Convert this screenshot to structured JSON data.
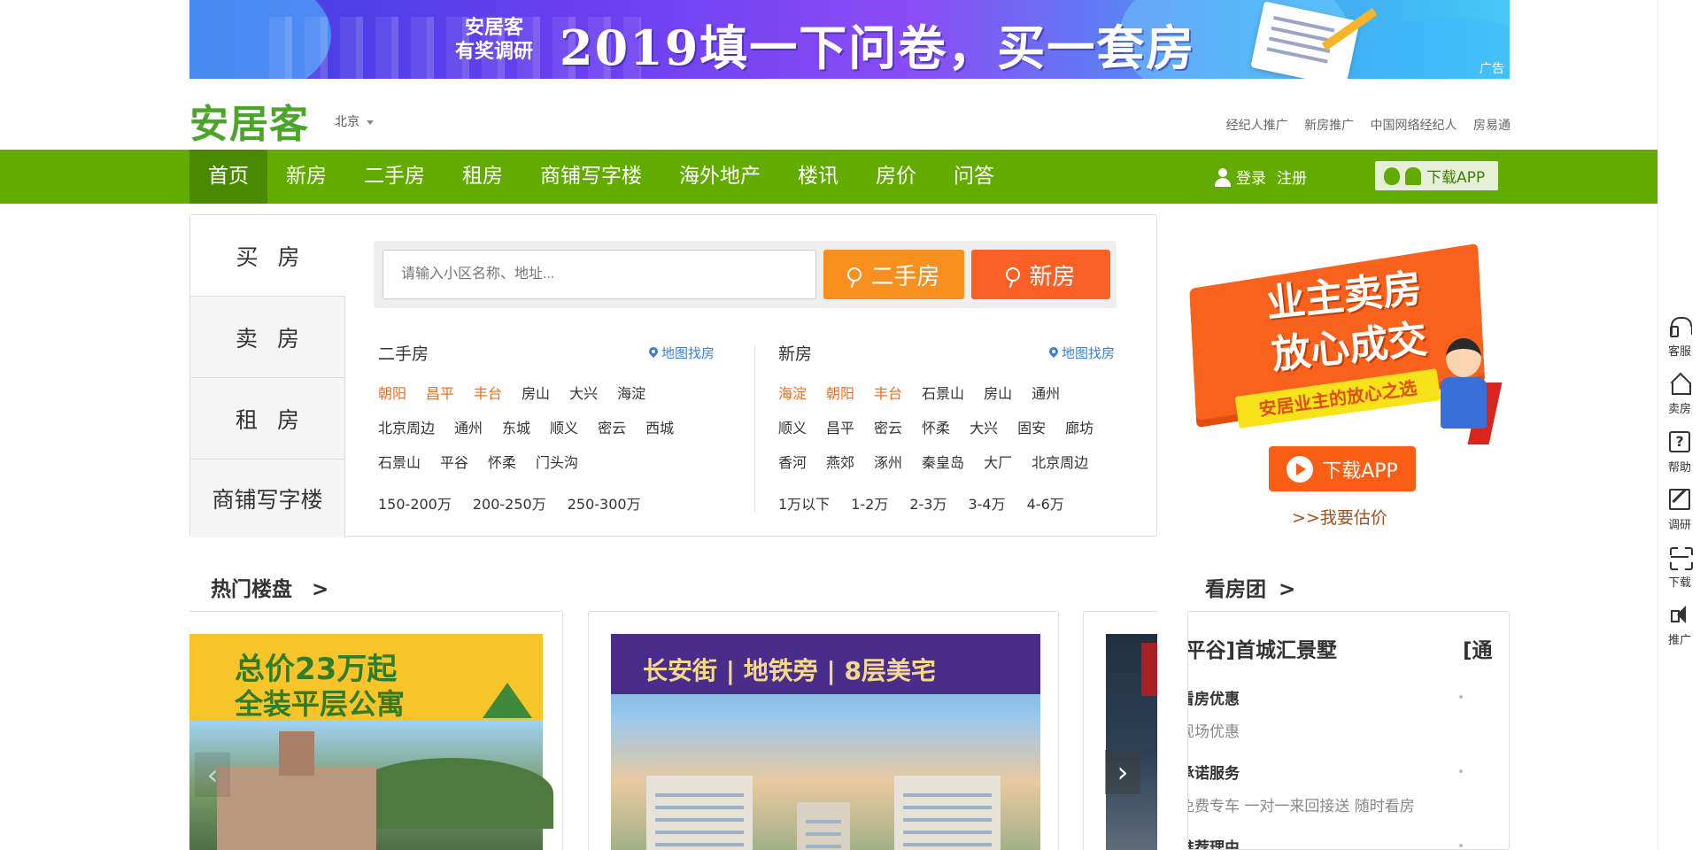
{
  "banner": {
    "brand_line1": "安居客",
    "brand_line2": "有奖调研",
    "headline": "2019填一下问卷，买一套房",
    "ad_tag": "广告"
  },
  "header": {
    "logo": "安居客",
    "city": "北京",
    "top_links": [
      "经纪人推广",
      "新房推广",
      "中国网络经纪人",
      "房易通"
    ]
  },
  "nav": {
    "items": [
      "首页",
      "新房",
      "二手房",
      "租房",
      "商铺写字楼",
      "海外地产",
      "楼讯",
      "房价",
      "问答"
    ],
    "login": "登录",
    "register": "注册",
    "download_app": "下载APP"
  },
  "panel": {
    "tabs": [
      "买房",
      "卖房",
      "租房",
      "商铺写字楼"
    ],
    "search_placeholder": "请输入小区名称、地址...",
    "btn_second_hand": "二手房",
    "btn_new": "新房",
    "second_hand": {
      "title": "二手房",
      "map_link": "地图找房",
      "hot_districts": [
        "朝阳",
        "昌平",
        "丰台"
      ],
      "districts_row1": [
        "房山",
        "大兴",
        "海淀"
      ],
      "districts_row2": [
        "北京周边",
        "通州",
        "东城",
        "顺义",
        "密云",
        "西城"
      ],
      "districts_row3": [
        "石景山",
        "平谷",
        "怀柔",
        "门头沟"
      ],
      "prices": [
        "150-200万",
        "200-250万",
        "250-300万"
      ]
    },
    "new_house": {
      "title": "新房",
      "map_link": "地图找房",
      "hot_districts": [
        "海淀",
        "朝阳",
        "丰台"
      ],
      "districts_row1": [
        "石景山",
        "房山",
        "通州"
      ],
      "districts_row2": [
        "顺义",
        "昌平",
        "密云",
        "怀柔",
        "大兴",
        "固安",
        "廊坊"
      ],
      "districts_row3": [
        "香河",
        "燕郊",
        "涿州",
        "秦皇岛",
        "大厂",
        "北京周边"
      ],
      "prices": [
        "1万以下",
        "1-2万",
        "2-3万",
        "3-4万",
        "4-6万"
      ]
    }
  },
  "promo": {
    "line1": "业主卖房",
    "line2": "放心成交",
    "ribbon": "安居业主的放心之选",
    "download_btn": "下载APP",
    "estimate_link": ">>我要估价"
  },
  "hot_listings": {
    "title": "热门楼盘",
    "arrow": ">",
    "card1_line1": "总价23万起",
    "card1_line2": "全装平层公寓",
    "card2_headline": "长安街 | 地铁旁 | 8层美宅",
    "prev": "‹",
    "next": "›"
  },
  "viewing_group": {
    "title": "看房团",
    "arrow": ">",
    "listing_name": "[平谷]首城汇景墅",
    "listing_name_next": "[通",
    "blocks": [
      {
        "title": "看房优惠",
        "desc": "现场优惠"
      },
      {
        "title": "承诺服务",
        "desc": "免费专车 一对一来回接送 随时看房"
      },
      {
        "title": "推荐理由",
        "desc": ""
      }
    ]
  },
  "sidebar": {
    "items": [
      "客服",
      "卖房",
      "帮助",
      "调研",
      "下载",
      "推广"
    ]
  },
  "colors": {
    "nav_green": "#62ab00",
    "orange_button": "#f7901e",
    "red_orange_button": "#fa6024",
    "hot_district": "#f26c1d",
    "map_link_blue": "#3a7fd5"
  }
}
